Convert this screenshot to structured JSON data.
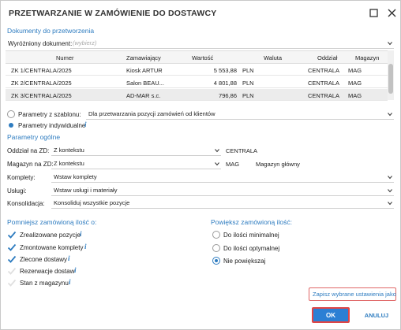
{
  "window": {
    "title": "PRZETWARZANIE W ZAMÓWIENIE DO DOSTAWCY"
  },
  "docs": {
    "section": "Dokumenty do przetworzenia",
    "featured_label": "Wyróżniony dokument:",
    "featured_placeholder": "(wybierz)",
    "columns": [
      "Numer",
      "Zamawiający",
      "Wartość",
      "Waluta",
      "Oddział",
      "Magazyn"
    ],
    "rows": [
      [
        "ZK 1/CENTRALA/2025",
        "Kiosk ARTUR",
        "5 553,88",
        "PLN",
        "CENTRALA",
        "MAG"
      ],
      [
        "ZK 2/CENTRALA/2025",
        "Salon BEAU...",
        "4 801,88",
        "PLN",
        "CENTRALA",
        "MAG"
      ],
      [
        "ZK 3/CENTRALA/2025",
        "AD-MAR s.c.",
        "796,86",
        "PLN",
        "CENTRALA",
        "MAG"
      ]
    ]
  },
  "params": {
    "template_label": "Parametry z szablonu:",
    "template_value": "Dla przetwarzania pozycji zamówień od klientów",
    "individual_label": "Parametry indywidualne",
    "selected": "individual"
  },
  "general": {
    "section": "Parametry ogólne",
    "branch_label": "Oddział na ZD:",
    "branch_value": "Z kontekstu",
    "branch_text": "CENTRALA",
    "warehouse_label": "Magazyn na ZD:",
    "warehouse_value": "Z kontekstu",
    "warehouse_code": "MAG",
    "warehouse_name": "Magazyn główny",
    "sets_label": "Komplety:",
    "sets_value": "Wstaw komplety",
    "services_label": "Usługi:",
    "services_value": "Wstaw usługi i materiały",
    "consolidation_label": "Konsolidacja:",
    "consolidation_value": "Konsoliduj wszystkie pozycje"
  },
  "decrease": {
    "section": "Pomniejsz zamówioną ilość o:",
    "items": [
      {
        "label": "Zrealizowane pozycje",
        "checked": true
      },
      {
        "label": "Zmontowane komplety",
        "checked": true
      },
      {
        "label": "Zlecone dostawy",
        "checked": true
      },
      {
        "label": "Rezerwacje dostaw",
        "checked": false
      },
      {
        "label": "Stan z magazynu",
        "checked": false
      }
    ]
  },
  "increase": {
    "section": "Powiększ zamówioną ilość:",
    "options": [
      "Do ilości minimalnej",
      "Do ilości optymalnej",
      "Nie powiększaj"
    ],
    "selected": 2
  },
  "footer": {
    "save_settings": "Zapisz wybrane ustawienia jako",
    "ok": "OK",
    "cancel": "ANULUJ"
  },
  "colors": {
    "accent": "#2e7cc0",
    "ok_bg": "#2b7fd4",
    "highlight": "#e04545"
  }
}
